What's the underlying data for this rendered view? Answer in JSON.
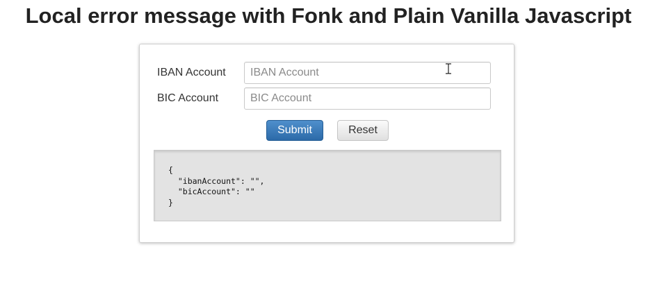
{
  "page": {
    "title": "Local error message with Fonk and Plain Vanilla Javascript"
  },
  "form": {
    "iban": {
      "label": "IBAN Account",
      "value": "",
      "placeholder": "IBAN Account"
    },
    "bic": {
      "label": "BIC Account",
      "value": "",
      "placeholder": "BIC Account"
    },
    "submit_label": "Submit",
    "reset_label": "Reset"
  },
  "output": {
    "json_text": "{\n  \"ibanAccount\": \"\",\n  \"bicAccount\": \"\"\n}"
  },
  "colors": {
    "submit_button": "#2f6fae",
    "output_background": "#e3e3e3"
  },
  "icons": {
    "cursor": "text-cursor-icon"
  }
}
